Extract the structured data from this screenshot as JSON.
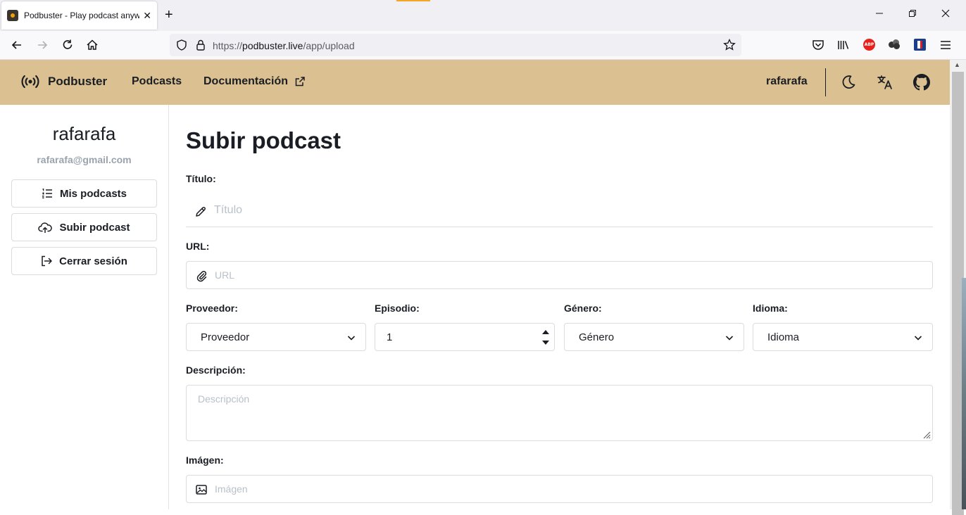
{
  "browser": {
    "tab_title": "Podbuster - Play podcast anywhere",
    "url_prefix": "https://",
    "url_host": "podbuster.live",
    "url_path": "/app/upload",
    "abp_label": "ABP"
  },
  "header": {
    "brand": "Podbuster",
    "nav_podcasts": "Podcasts",
    "nav_docs": "Documentación",
    "username": "rafarafa"
  },
  "sidebar": {
    "name": "rafarafa",
    "email": "rafarafa@gmail.com",
    "items": [
      {
        "label": "Mis podcasts",
        "icon": "list-icon"
      },
      {
        "label": "Subir podcast",
        "icon": "cloud-upload-icon"
      },
      {
        "label": "Cerrar sesión",
        "icon": "logout-icon"
      }
    ]
  },
  "form": {
    "page_title": "Subir podcast",
    "title_label": "Título:",
    "title_placeholder": "Título",
    "url_label": "URL:",
    "url_placeholder": "URL",
    "provider_label": "Proveedor:",
    "provider_value": "Proveedor",
    "episode_label": "Episodio:",
    "episode_value": "1",
    "genre_label": "Género:",
    "genre_value": "Género",
    "language_label": "Idioma:",
    "language_value": "Idioma",
    "description_label": "Descripción:",
    "description_placeholder": "Descripción",
    "image_label": "Imágen:",
    "image_placeholder": "Imágen"
  },
  "colors": {
    "header_bg": "#dbc191",
    "text": "#1a1d23",
    "placeholder": "#b9c0c8"
  }
}
